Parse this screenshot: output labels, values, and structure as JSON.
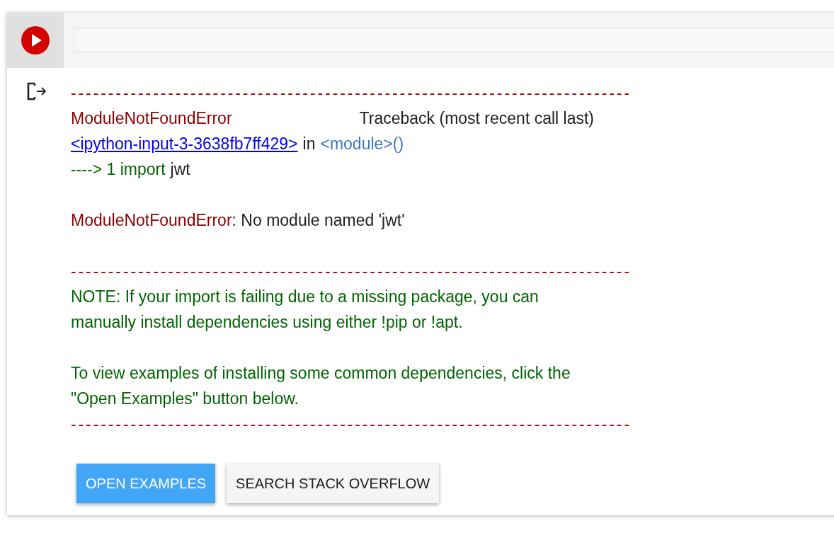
{
  "cell": {
    "output": [
      [
        {
          "segments": [
            {
              "kind": "rule",
              "text": "---------------------------------------------------------------------------"
            }
          ]
        },
        {
          "segments": [
            {
              "kind": "error",
              "text": "ModuleNotFoundError"
            },
            {
              "kind": "far",
              "text": "Traceback (most recent call last)"
            }
          ]
        },
        {
          "segments": [
            {
              "kind": "link",
              "text": "<ipython-input-3-3638fb7ff429>"
            },
            {
              "kind": "plain",
              "text": "in"
            },
            {
              "kind": "module",
              "text": "<module>()"
            }
          ]
        },
        {
          "segments": [
            {
              "kind": "green",
              "text": "----> 1 import"
            },
            {
              "kind": "plain",
              "text": "jwt"
            }
          ]
        }
      ],
      [
        {
          "segments": [
            {
              "kind": "error",
              "text": "ModuleNotFoundError"
            },
            {
              "kind": "plain-tight",
              "text": ": No module named 'jwt'"
            }
          ]
        }
      ],
      [
        {
          "segments": [
            {
              "kind": "rule",
              "text": "---------------------------------------------------------------------------"
            }
          ]
        },
        {
          "segments": [
            {
              "kind": "green",
              "text": "NOTE: If your import is failing due to a missing package, you can"
            }
          ]
        },
        {
          "segments": [
            {
              "kind": "green",
              "text": "manually install dependencies using either !pip or !apt."
            }
          ]
        }
      ],
      [
        {
          "segments": [
            {
              "kind": "green",
              "text": "To view examples of installing some common dependencies, click the"
            }
          ]
        },
        {
          "segments": [
            {
              "kind": "green",
              "text": "\"Open Examples\" button below."
            }
          ]
        },
        {
          "segments": [
            {
              "kind": "rule",
              "text": "---------------------------------------------------------------------------"
            }
          ]
        }
      ]
    ],
    "buttons": [
      {
        "label": "OPEN EXAMPLES",
        "kind": "primary"
      },
      {
        "label": "SEARCH STACK OVERFLOW",
        "kind": "secondary"
      }
    ]
  }
}
